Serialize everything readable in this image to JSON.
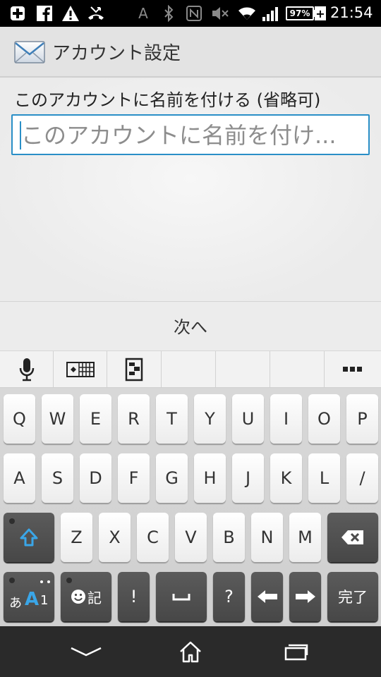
{
  "status_bar": {
    "clock": "21:54",
    "battery_percent": "97%",
    "ime_indicator": "A",
    "icons": [
      "medical-plus-icon",
      "facebook-icon",
      "warning-icon",
      "missed-call-icon",
      "ime-a-icon",
      "bluetooth-icon",
      "nfc-icon",
      "mute-icon",
      "wifi-icon",
      "signal-icon",
      "battery-icon",
      "charging-plus-icon"
    ]
  },
  "action_bar": {
    "title": "アカウント設定",
    "icon": "mail-icon"
  },
  "form": {
    "label": "このアカウントに名前を付ける (省略可)",
    "input_value": "",
    "input_placeholder": "このアカウントに名前を付け..."
  },
  "next": {
    "label": "次へ"
  },
  "keyboard": {
    "toolbar": [
      "mic-icon",
      "cursor-keys-icon",
      "clipboard-icon",
      "",
      "",
      "",
      "more-icon"
    ],
    "row1": [
      "Q",
      "W",
      "E",
      "R",
      "T",
      "Y",
      "U",
      "I",
      "O",
      "P"
    ],
    "row2": [
      "A",
      "S",
      "D",
      "F",
      "G",
      "H",
      "J",
      "K",
      "L",
      "/"
    ],
    "row3": [
      "Z",
      "X",
      "C",
      "V",
      "B",
      "N",
      "M"
    ],
    "row4": {
      "mode_kana": "あ",
      "mode_alpha": "A",
      "mode_num": "1",
      "emoji_label": "記",
      "excl": "!",
      "question": "?",
      "done": "完了"
    },
    "accent_color": "#2a8fc7"
  },
  "nav_bar": {
    "icons": [
      "back-chevron-icon",
      "home-icon",
      "recents-icon"
    ]
  }
}
